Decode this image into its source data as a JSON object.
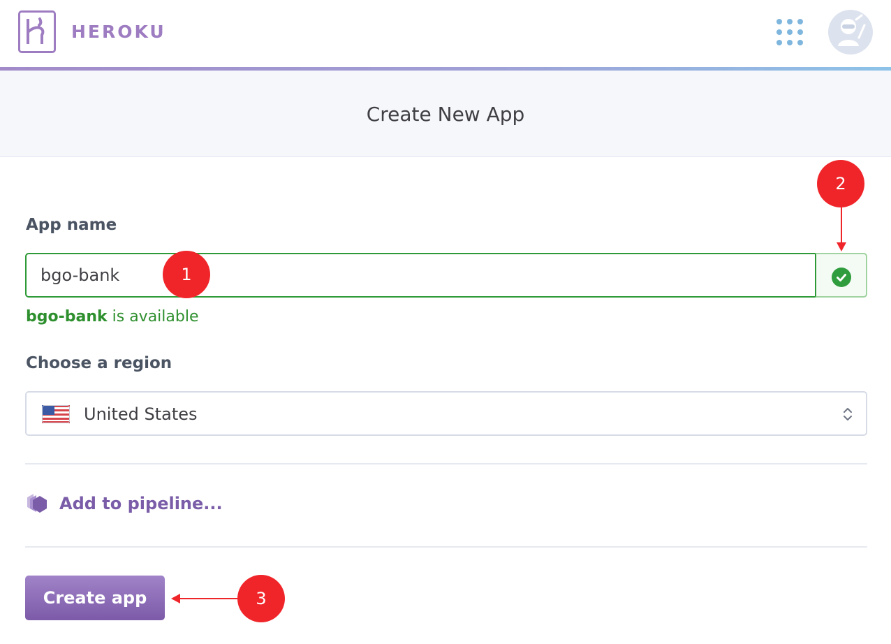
{
  "nav": {
    "brand": "HEROKU",
    "icons": {
      "logo": "heroku-logo-icon",
      "apps": "apps-grid-icon",
      "avatar": "ninja-avatar-icon"
    }
  },
  "header": {
    "title": "Create New App"
  },
  "form": {
    "app_name_label": "App name",
    "app_name_value": "bgo-bank",
    "availability_name": "bgo-bank",
    "availability_suffix": " is available",
    "region_label": "Choose a region",
    "region_value": "United States",
    "pipeline_label": "Add to pipeline...",
    "create_button": "Create app"
  },
  "annotations": {
    "step1": "1",
    "step2": "2",
    "step3": "3"
  },
  "colors": {
    "brand_purple": "#9e7cc1",
    "valid_green": "#2e9a37",
    "annotation_red": "#f0252a",
    "link_purple": "#7a5ca8"
  }
}
